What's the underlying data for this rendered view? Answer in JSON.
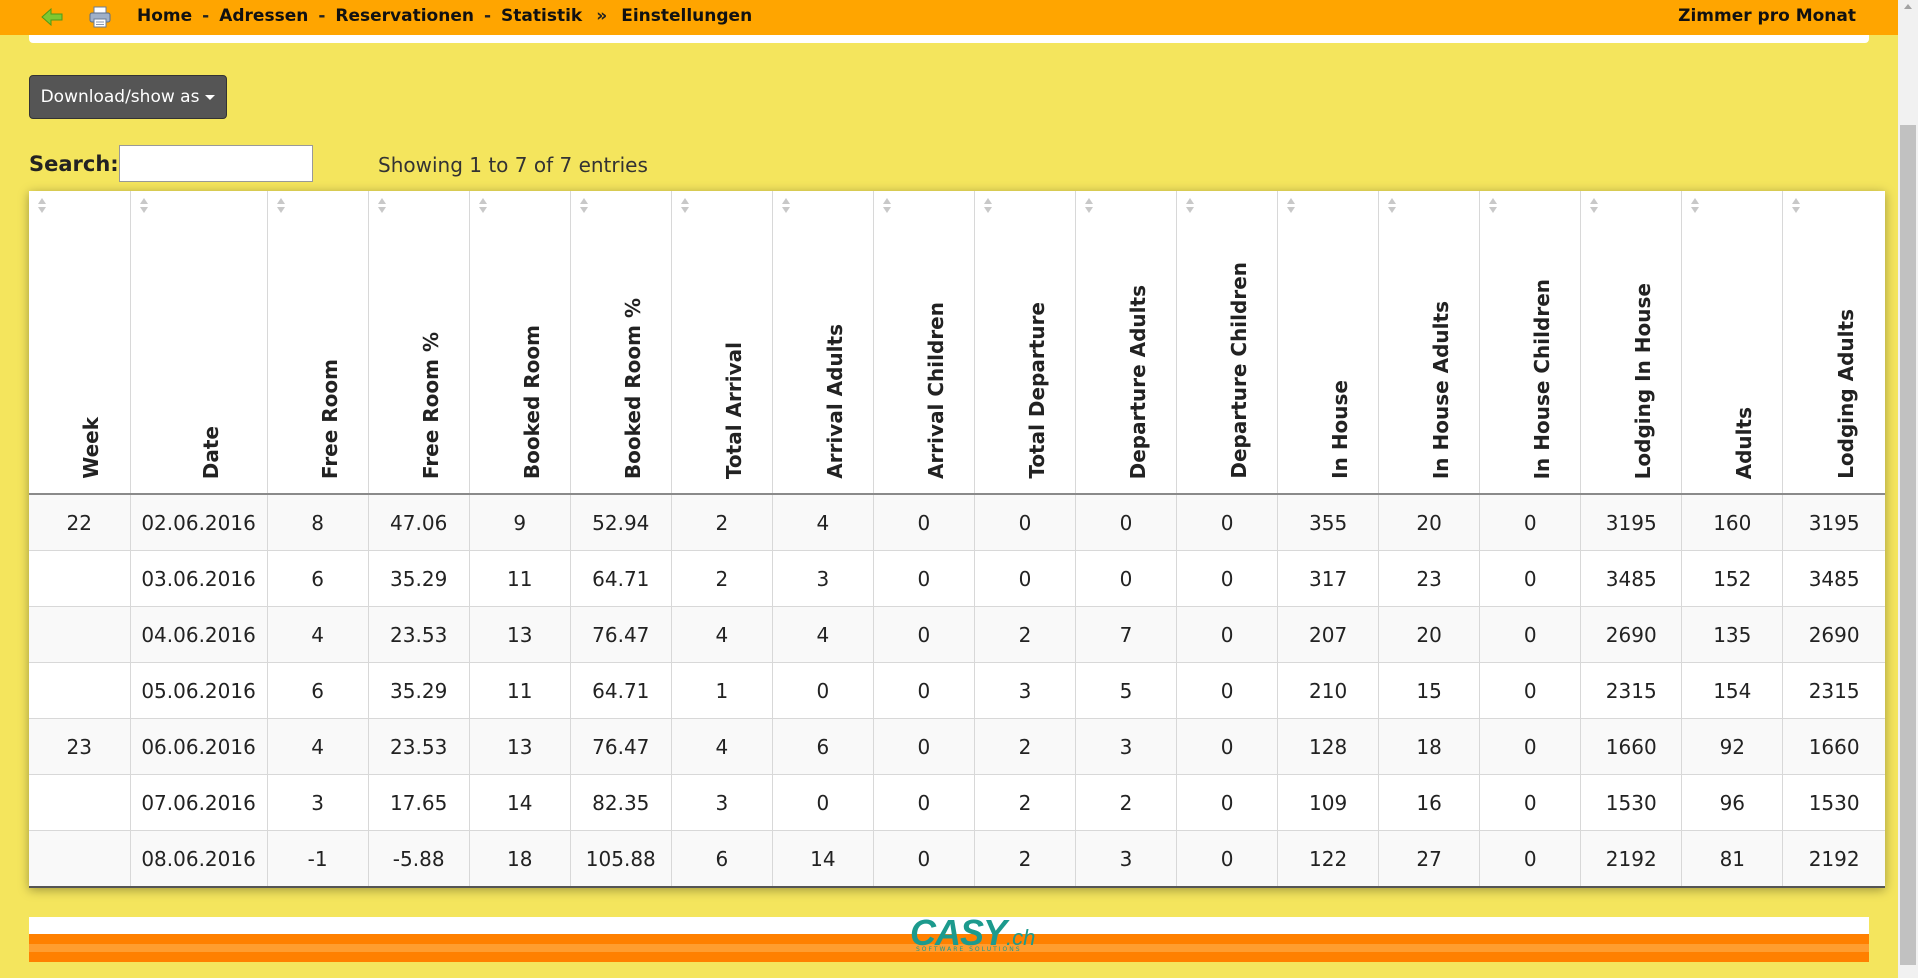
{
  "nav": {
    "items": [
      "Home",
      "Adressen",
      "Reservationen",
      "Statistik",
      "Einstellungen"
    ],
    "separator": "-",
    "arrow_separator": "»",
    "page_title": "Zimmer pro Monat"
  },
  "icons": {
    "back": "back-arrow-icon",
    "print": "printer-icon",
    "sort": "sort-icon",
    "caret": "caret-down-icon"
  },
  "controls": {
    "download_label": "Download/show as",
    "search_label": "Search:",
    "search_value": "",
    "showing_text": "Showing 1 to 7 of 7 entries"
  },
  "table": {
    "columns": [
      "Week",
      "Date",
      "Free Room",
      "Free Room %",
      "Booked Room",
      "Booked Room %",
      "Total Arrival",
      "Arrival Adults",
      "Arrival Children",
      "Total Departure",
      "Departure Adults",
      "Departure Children",
      "In House",
      "In House Adults",
      "In House Children",
      "Lodging In House",
      "Adults",
      "Lodging Adults"
    ],
    "rows": [
      [
        "22",
        "02.06.2016",
        "8",
        "47.06",
        "9",
        "52.94",
        "2",
        "4",
        "0",
        "0",
        "0",
        "0",
        "355",
        "20",
        "0",
        "3195",
        "160",
        "3195"
      ],
      [
        "",
        "03.06.2016",
        "6",
        "35.29",
        "11",
        "64.71",
        "2",
        "3",
        "0",
        "0",
        "0",
        "0",
        "317",
        "23",
        "0",
        "3485",
        "152",
        "3485"
      ],
      [
        "",
        "04.06.2016",
        "4",
        "23.53",
        "13",
        "76.47",
        "4",
        "4",
        "0",
        "2",
        "7",
        "0",
        "207",
        "20",
        "0",
        "2690",
        "135",
        "2690"
      ],
      [
        "",
        "05.06.2016",
        "6",
        "35.29",
        "11",
        "64.71",
        "1",
        "0",
        "0",
        "3",
        "5",
        "0",
        "210",
        "15",
        "0",
        "2315",
        "154",
        "2315"
      ],
      [
        "23",
        "06.06.2016",
        "4",
        "23.53",
        "13",
        "76.47",
        "4",
        "6",
        "0",
        "2",
        "3",
        "0",
        "128",
        "18",
        "0",
        "1660",
        "92",
        "1660"
      ],
      [
        "",
        "07.06.2016",
        "3",
        "17.65",
        "14",
        "82.35",
        "3",
        "0",
        "0",
        "2",
        "2",
        "0",
        "109",
        "16",
        "0",
        "1530",
        "96",
        "1530"
      ],
      [
        "",
        "08.06.2016",
        "-1",
        "-5.88",
        "18",
        "105.88",
        "6",
        "14",
        "0",
        "2",
        "3",
        "0",
        "122",
        "27",
        "0",
        "2192",
        "81",
        "2192"
      ]
    ]
  },
  "footer": {
    "logo_main": "CASY",
    "logo_suffix": ".ch",
    "logo_sub": "SOFTWARE SOLUTIONS"
  },
  "colors": {
    "background": "#f4e55d",
    "topbar": "#ffa500",
    "button": "#555555",
    "footer_band": "#ff8000",
    "logo": "#1c9a8d"
  }
}
